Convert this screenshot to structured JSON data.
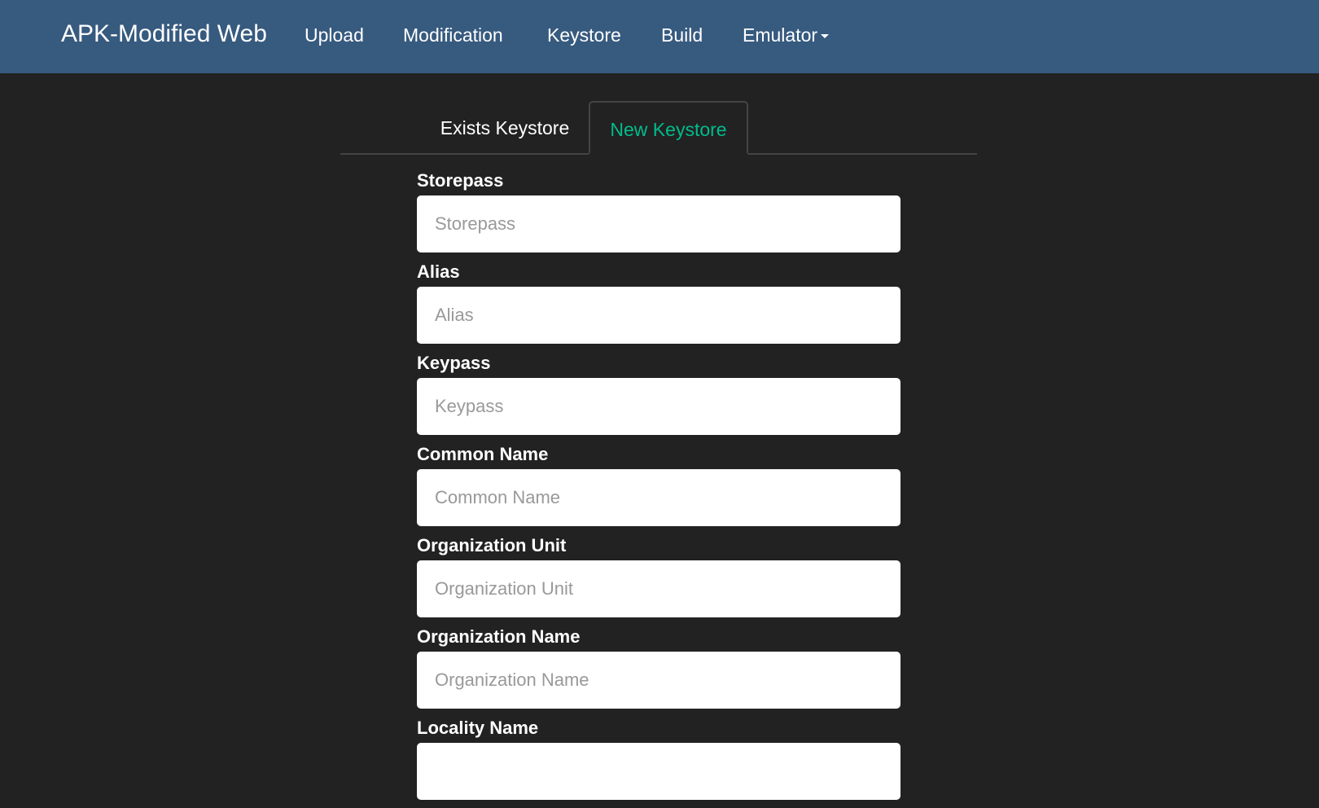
{
  "navbar": {
    "brand": "APK-Modified Web",
    "links": [
      "Upload",
      "Modification",
      "Keystore",
      "Build"
    ],
    "dropdown_label": "Emulator",
    "background_color": "#375a7f"
  },
  "tabs": {
    "items": [
      "Exists Keystore",
      "New Keystore"
    ],
    "active": "New Keystore",
    "active_color": "#00bc8c"
  },
  "form": {
    "fields": [
      {
        "label": "Storepass",
        "placeholder": "Storepass",
        "value": ""
      },
      {
        "label": "Alias",
        "placeholder": "Alias",
        "value": ""
      },
      {
        "label": "Keypass",
        "placeholder": "Keypass",
        "value": ""
      },
      {
        "label": "Common Name",
        "placeholder": "Common Name",
        "value": ""
      },
      {
        "label": "Organization Unit",
        "placeholder": "Organization Unit",
        "value": ""
      },
      {
        "label": "Organization Name",
        "placeholder": "Organization Name",
        "value": ""
      },
      {
        "label": "Locality Name",
        "placeholder": "",
        "value": ""
      }
    ]
  },
  "page_background": "#222222"
}
